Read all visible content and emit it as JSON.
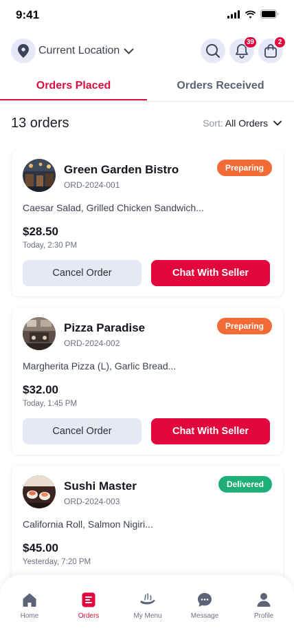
{
  "status_bar": {
    "time": "9:41"
  },
  "header": {
    "location_label": "Current Location",
    "notification_count": "39",
    "cart_count": "2"
  },
  "tabs": [
    {
      "label": "Orders Placed",
      "active": true
    },
    {
      "label": "Orders Received",
      "active": false
    }
  ],
  "summary": {
    "count_text": "13 orders",
    "sort_label": "Sort:",
    "sort_value": "All Orders"
  },
  "orders": [
    {
      "name": "Green Garden Bistro",
      "order_id": "ORD-2024-001",
      "status": "Preparing",
      "status_color": "#f26b37",
      "items": "Caesar Salad, Grilled Chicken Sandwich...",
      "price": "$28.50",
      "time": "Today, 2:30 PM",
      "cancel_label": "Cancel Order",
      "chat_label": "Chat  With Seller"
    },
    {
      "name": "Pizza Paradise",
      "order_id": "ORD-2024-002",
      "status": "Preparing",
      "status_color": "#f26b37",
      "items": "Margherita Pizza (L), Garlic Bread...",
      "price": "$32.00",
      "time": "Today, 1:45 PM",
      "cancel_label": "Cancel Order",
      "chat_label": "Chat  With Seller"
    },
    {
      "name": "Sushi Master",
      "order_id": "ORD-2024-003",
      "status": "Delivered",
      "status_color": "#1fae78",
      "items": "California Roll, Salmon Nigiri...",
      "price": "$45.00",
      "time": "Yesterday, 7:20 PM"
    }
  ],
  "bottom_nav": [
    {
      "label": "Home",
      "icon": "home-icon",
      "active": false
    },
    {
      "label": "Orders",
      "icon": "orders-icon",
      "active": true
    },
    {
      "label": "My Menu",
      "icon": "menu-icon",
      "active": false
    },
    {
      "label": "Message",
      "icon": "message-icon",
      "active": false
    },
    {
      "label": "Profile",
      "icon": "profile-icon",
      "active": false
    }
  ],
  "colors": {
    "accent": "#e3063d",
    "tab_active": "#d80d3f",
    "icon_circle": "#e6e8f7",
    "preparing": "#f26b37",
    "delivered": "#1fae78"
  }
}
